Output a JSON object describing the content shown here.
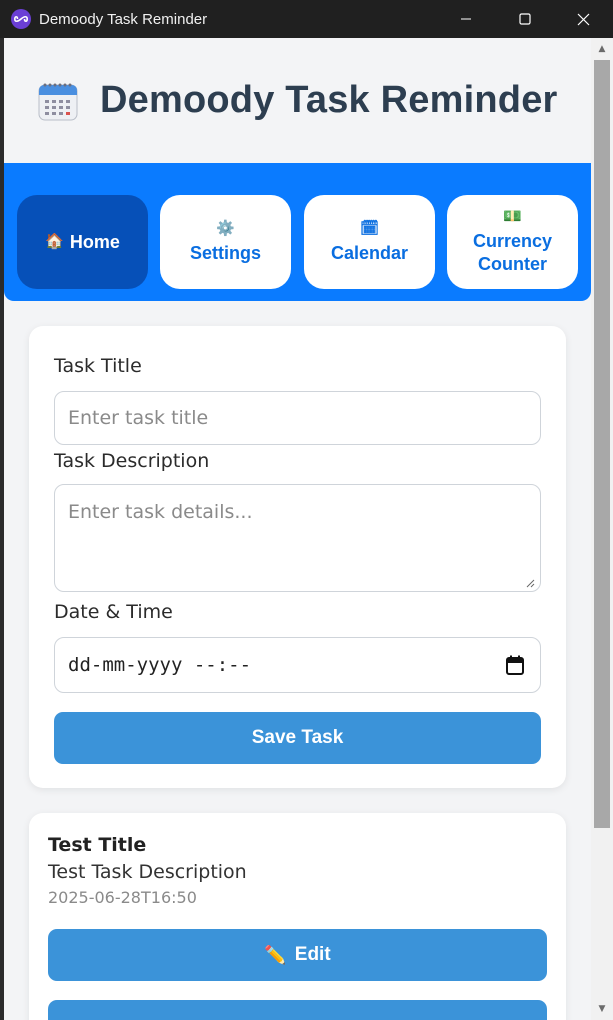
{
  "window": {
    "title": "Demoody Task Reminder",
    "icon": "app-logo-icon"
  },
  "header": {
    "title": "Demoody Task Reminder",
    "icon": "calendar-icon"
  },
  "nav": {
    "items": [
      {
        "icon": "🏠",
        "label": "Home",
        "active": true
      },
      {
        "icon": "⚙️",
        "label": "Settings",
        "active": false
      },
      {
        "icon": "🗓",
        "label": "Calendar",
        "active": false
      },
      {
        "icon": "💵",
        "label": "Currency Counter",
        "active": false
      }
    ]
  },
  "form": {
    "title_label": "Task Title",
    "title_placeholder": "Enter task title",
    "description_label": "Task Description",
    "description_placeholder": "Enter task details...",
    "datetime_label": "Date & Time",
    "datetime_value": "dd-mm-yyyy --:--",
    "save_label": "Save Task"
  },
  "tasks": [
    {
      "title": "Test Title",
      "description": "Test Task Description",
      "datetime": "2025-06-28T16:50",
      "edit_icon": "✏️",
      "edit_label": "Edit"
    }
  ],
  "colors": {
    "nav_background": "#0a7bff",
    "nav_active": "#0650b8",
    "primary_button": "#3b93d9",
    "heading": "#2d3e50"
  }
}
